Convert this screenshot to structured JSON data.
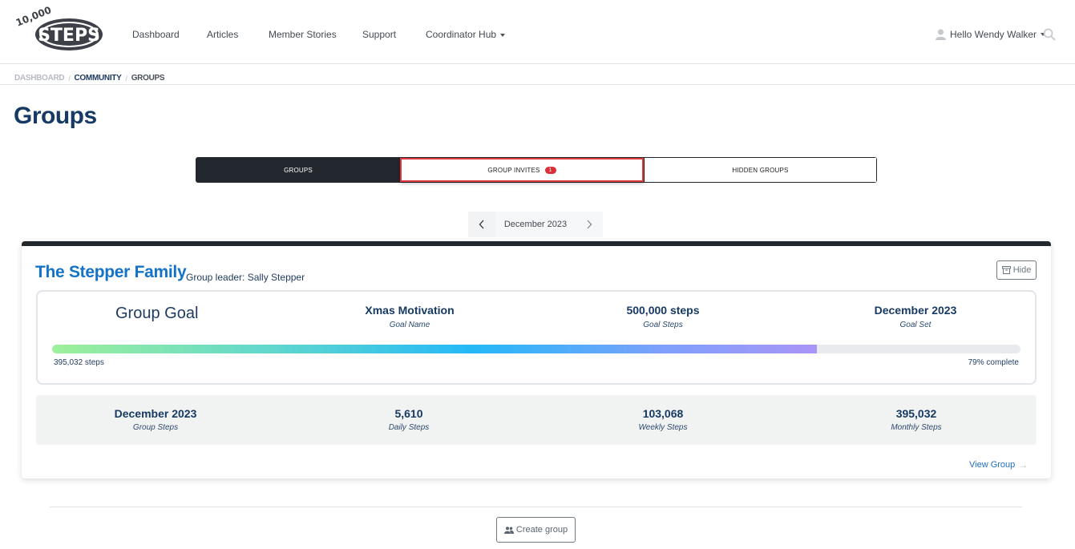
{
  "header": {
    "logo_alt": "10,000 Steps",
    "logo_top": "10,000",
    "logo_main": "STEPS",
    "nav": [
      {
        "label": "Dashboard"
      },
      {
        "label": "Articles"
      },
      {
        "label": "Member Stories"
      },
      {
        "label": "Support"
      },
      {
        "label": "Coordinator Hub",
        "has_dropdown": true
      }
    ],
    "user_greeting": "Hello Wendy Walker",
    "icons": {
      "user": "user-icon",
      "search": "search-icon"
    }
  },
  "breadcrumb": [
    {
      "label": "DASHBOARD"
    },
    {
      "label": "COMMUNITY"
    },
    {
      "label": "GROUPS"
    }
  ],
  "page_title": "Groups",
  "tabs": [
    {
      "label": "GROUPS",
      "active": true
    },
    {
      "label": "GROUP INVITES",
      "badge": "1",
      "highlighted": true
    },
    {
      "label": "HIDDEN GROUPS"
    }
  ],
  "month_selector": {
    "label": "December 2023",
    "prev_icon": "‹",
    "next_icon": "›"
  },
  "group_card": {
    "name": "The Stepper Family",
    "leader": "Group leader: Sally Stepper",
    "hide_label": "Hide",
    "goal": {
      "title": "Group Goal",
      "columns": [
        {
          "value": "Xmas Motivation",
          "label": "Goal Name"
        },
        {
          "value": "500,000 steps",
          "label": "Goal Steps"
        },
        {
          "value": "December 2023",
          "label": "Goal Set"
        }
      ],
      "progress_percent": 79,
      "progress_steps": "395,032 steps",
      "progress_label": "79% complete"
    },
    "stats": [
      {
        "value": "December 2023",
        "label": "Group Steps"
      },
      {
        "value": "5,610",
        "label": "Daily Steps"
      },
      {
        "value": "103,068",
        "label": "Weekly Steps"
      },
      {
        "value": "395,032",
        "label": "Monthly Steps"
      }
    ],
    "view_group_label": "View Group",
    "colors": {
      "accent": "#1373c9",
      "header_bar": "#23272e"
    }
  },
  "create_group_label": "Create group"
}
